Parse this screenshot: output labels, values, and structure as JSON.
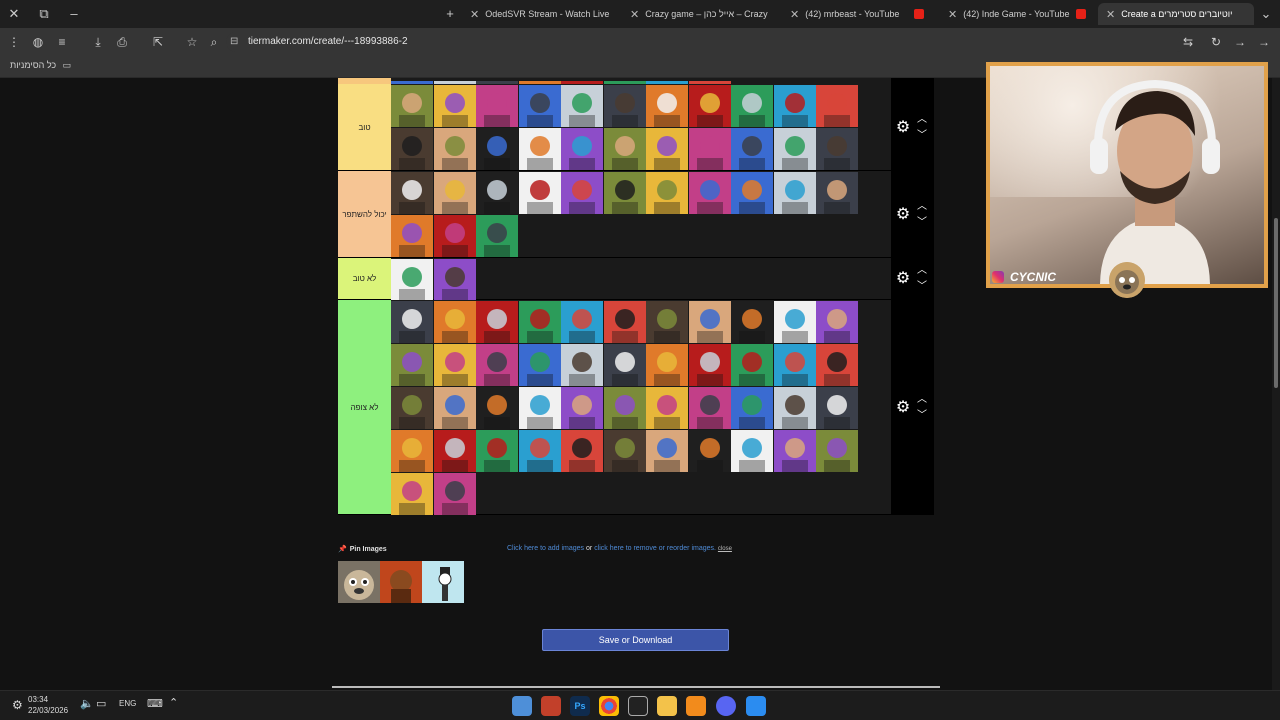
{
  "browser": {
    "tabs": [
      {
        "label": "OdedSVR Stream - Watch Live",
        "active": false
      },
      {
        "label": "Crazy game – אייל כהן – Crazy",
        "active": false
      },
      {
        "label": "(42) mrbeast - YouTube",
        "active": false
      },
      {
        "label": "(42) Inde Game - YouTube",
        "active": false
      },
      {
        "label": "Create a יוטיוברים סטרימרים",
        "active": true
      }
    ],
    "url": "tiermaker.com/create/---18993886-2",
    "bookmarks_label": "כל הסימניות"
  },
  "tiers": [
    {
      "label": "",
      "color": "#f7c77d",
      "count": 8
    },
    {
      "label": "טוב",
      "color": "#f9de82",
      "count": 22
    },
    {
      "label": "יכול להשתפר",
      "color": "#f6c594",
      "count": 14
    },
    {
      "label": "לא טוב",
      "color": "#dbf47a",
      "count": 2
    },
    {
      "label": "לא צופה",
      "color": "#8ef07e",
      "count": 46
    }
  ],
  "pin": {
    "label": "Pin Images",
    "add_link": "Click here to add images",
    "or_text": "or",
    "remove_link": "click here to remove or reorder images.",
    "close_link": "close"
  },
  "save_button": "Save or Download",
  "webcam": {
    "name": "CYCNIC"
  },
  "taskbar": {
    "time": "03:34",
    "date": "22/03/2026",
    "lang": "ENG"
  },
  "colors": {
    "accent_blue": "#3c55a8",
    "link": "#4f8bd6",
    "cam_border": "#e1a14a"
  }
}
